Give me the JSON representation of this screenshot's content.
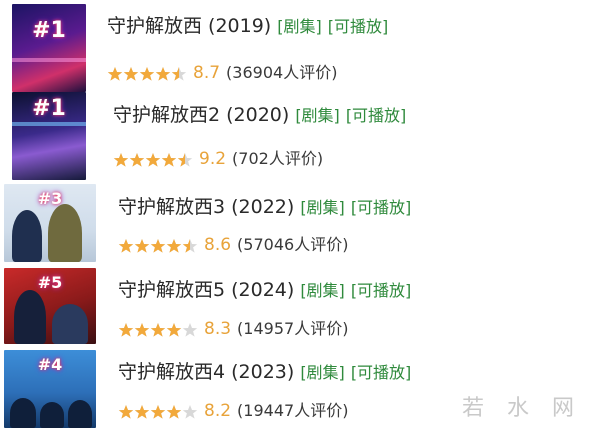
{
  "items": [
    {
      "title": "守护解放西 (2019)",
      "tag_series": "[剧集]",
      "tag_play": "[可播放]",
      "score": "8.7",
      "votes": "(36904人评价)",
      "stars": 4.5,
      "badge": "#1"
    },
    {
      "title": "守护解放西2 (2020)",
      "tag_series": "[剧集]",
      "tag_play": "[可播放]",
      "score": "9.2",
      "votes": "(702人评价)",
      "stars": 4.5,
      "badge": "#1"
    },
    {
      "title": "守护解放西3 (2022)",
      "tag_series": "[剧集]",
      "tag_play": "[可播放]",
      "score": "8.6",
      "votes": "(57046人评价)",
      "stars": 4.5,
      "badge": "#3"
    },
    {
      "title": "守护解放西5 (2024)",
      "tag_series": "[剧集]",
      "tag_play": "[可播放]",
      "score": "8.3",
      "votes": "(14957人评价)",
      "stars": 4,
      "badge": "#5"
    },
    {
      "title": "守护解放西4 (2023)",
      "tag_series": "[剧集]",
      "tag_play": "[可播放]",
      "score": "8.2",
      "votes": "(19447人评价)",
      "stars": 4,
      "badge": "#4"
    }
  ],
  "watermark": "若 水 网",
  "colors": {
    "star": "#f2a93b",
    "tag": "#2f8a3c",
    "score": "#e8a33a"
  }
}
